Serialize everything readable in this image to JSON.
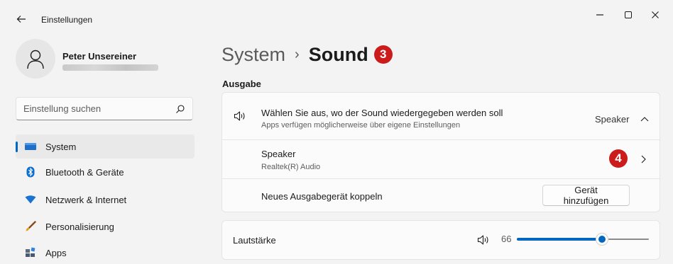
{
  "window": {
    "title": "Einstellungen",
    "minimize_glyph": "–",
    "maximize_glyph": "▢",
    "close_glyph": "✕"
  },
  "profile": {
    "name": "Peter Unsereiner"
  },
  "search": {
    "placeholder": "Einstellung suchen"
  },
  "sidebar": {
    "items": [
      {
        "label": "System",
        "icon": "system-monitor-icon",
        "selected": true
      },
      {
        "label": "Bluetooth & Geräte",
        "icon": "bluetooth-icon",
        "selected": false
      },
      {
        "label": "Netzwerk & Internet",
        "icon": "wifi-icon",
        "selected": false
      },
      {
        "label": "Personalisierung",
        "icon": "brush-icon",
        "selected": false
      },
      {
        "label": "Apps",
        "icon": "apps-icon",
        "selected": false
      }
    ]
  },
  "breadcrumb": {
    "parent": "System",
    "separator": "›",
    "current": "Sound",
    "marker": "3"
  },
  "output": {
    "section_title": "Ausgabe",
    "chooser": {
      "title": "Wählen Sie aus, wo der Sound wiedergegeben werden soll",
      "subtitle": "Apps verfügen möglicherweise über eigene Einstellungen",
      "value": "Speaker"
    },
    "device": {
      "title": "Speaker",
      "subtitle": "Realtek(R) Audio",
      "marker": "4"
    },
    "pair": {
      "title": "Neues Ausgabegerät koppeln",
      "button_label": "Gerät hinzufügen"
    }
  },
  "volume": {
    "label": "Lautstärke",
    "value": "66",
    "level": 66
  },
  "colors": {
    "accent": "#0067c0",
    "marker_red": "#cc1b1b"
  }
}
